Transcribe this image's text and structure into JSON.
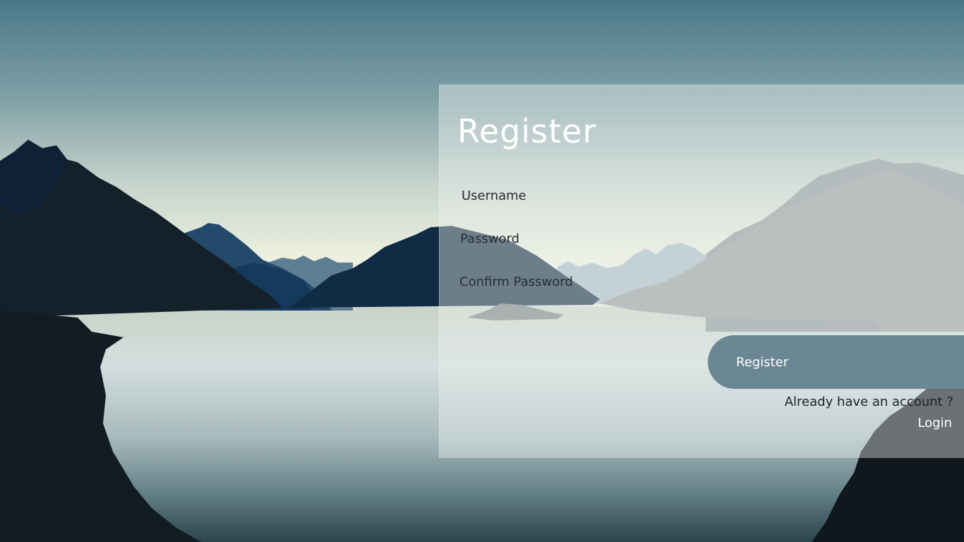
{
  "form": {
    "title": "Register",
    "username_placeholder": "Username",
    "password_placeholder": "Password",
    "confirm_password_placeholder": "Confirm Password",
    "submit_label": "Register",
    "account_prompt": "Already have an account ?",
    "login_link": "Login"
  },
  "colors": {
    "button": "#6a8793",
    "sky_top": "#4a7788",
    "horizon": "#eef2e2",
    "mountain_dark": "#14202a",
    "mountain_blue": "#1f3f5e"
  }
}
